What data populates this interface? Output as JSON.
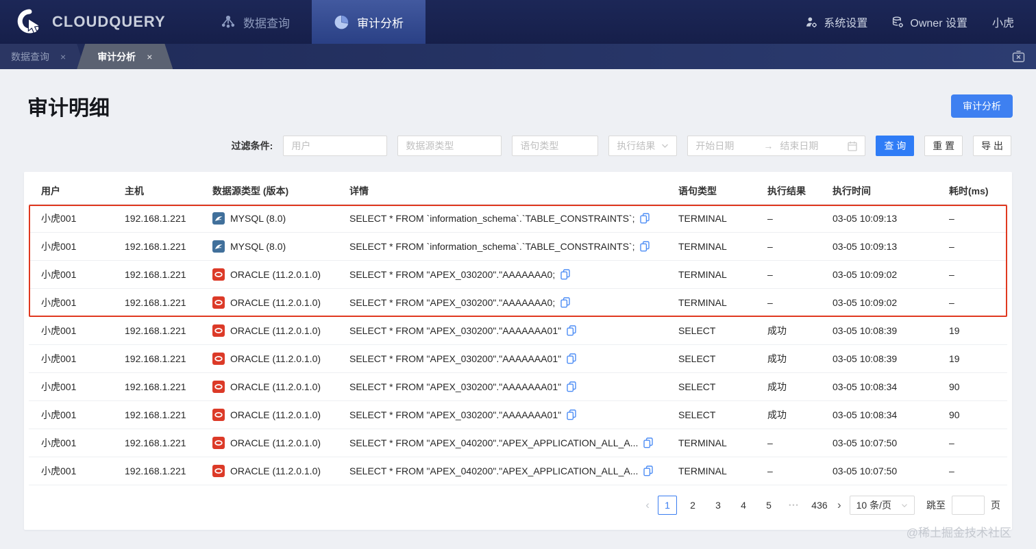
{
  "navbar": {
    "brand": "CLOUDQUERY",
    "items": [
      {
        "label": "数据查询",
        "icon": "network-icon"
      },
      {
        "label": "审计分析",
        "icon": "pie-chart-icon"
      }
    ],
    "right": [
      {
        "label": "系统设置",
        "icon": "user-gear-icon"
      },
      {
        "label": "Owner 设置",
        "icon": "database-gear-icon"
      },
      {
        "label": "小虎"
      }
    ]
  },
  "tabbar": {
    "tabs": [
      {
        "label": "数据查询",
        "active": false
      },
      {
        "label": "审计分析",
        "active": true
      }
    ]
  },
  "page": {
    "title": "审计明细",
    "action_button": "审计分析"
  },
  "filters": {
    "label": "过滤条件:",
    "user_placeholder": "用户",
    "datasource_placeholder": "数据源类型",
    "statement_placeholder": "语句类型",
    "result_placeholder": "执行结果",
    "start_date_placeholder": "开始日期",
    "date_arrow": "→",
    "end_date_placeholder": "结束日期",
    "query_button": "查 询",
    "reset_button": "重 置",
    "export_button": "导 出"
  },
  "table": {
    "columns": [
      "用户",
      "主机",
      "数据源类型 (版本)",
      "详情",
      "语句类型",
      "执行结果",
      "执行时间",
      "耗时(ms)"
    ],
    "rows": [
      {
        "user": "小虎001",
        "host": "192.168.1.221",
        "ds_kind": "mysql",
        "datasource": "MYSQL (8.0)",
        "detail": "SELECT * FROM `information_schema`.`TABLE_CONSTRAINTS`;",
        "stmt_type": "TERMINAL",
        "result": "–",
        "time": "03-05 10:09:13",
        "cost": "–",
        "highlighted": true
      },
      {
        "user": "小虎001",
        "host": "192.168.1.221",
        "ds_kind": "mysql",
        "datasource": "MYSQL (8.0)",
        "detail": "SELECT * FROM `information_schema`.`TABLE_CONSTRAINTS`;",
        "stmt_type": "TERMINAL",
        "result": "–",
        "time": "03-05 10:09:13",
        "cost": "–",
        "highlighted": true
      },
      {
        "user": "小虎001",
        "host": "192.168.1.221",
        "ds_kind": "oracle",
        "datasource": "ORACLE (11.2.0.1.0)",
        "detail": "SELECT * FROM \"APEX_030200\".\"AAAAAAA0;",
        "stmt_type": "TERMINAL",
        "result": "–",
        "time": "03-05 10:09:02",
        "cost": "–",
        "highlighted": true
      },
      {
        "user": "小虎001",
        "host": "192.168.1.221",
        "ds_kind": "oracle",
        "datasource": "ORACLE (11.2.0.1.0)",
        "detail": "SELECT * FROM \"APEX_030200\".\"AAAAAAA0;",
        "stmt_type": "TERMINAL",
        "result": "–",
        "time": "03-05 10:09:02",
        "cost": "–",
        "highlighted": true
      },
      {
        "user": "小虎001",
        "host": "192.168.1.221",
        "ds_kind": "oracle",
        "datasource": "ORACLE (11.2.0.1.0)",
        "detail": "SELECT * FROM \"APEX_030200\".\"AAAAAAA01\"",
        "stmt_type": "SELECT",
        "result": "成功",
        "time": "03-05 10:08:39",
        "cost": "19",
        "highlighted": false
      },
      {
        "user": "小虎001",
        "host": "192.168.1.221",
        "ds_kind": "oracle",
        "datasource": "ORACLE (11.2.0.1.0)",
        "detail": "SELECT * FROM \"APEX_030200\".\"AAAAAAA01\"",
        "stmt_type": "SELECT",
        "result": "成功",
        "time": "03-05 10:08:39",
        "cost": "19",
        "highlighted": false
      },
      {
        "user": "小虎001",
        "host": "192.168.1.221",
        "ds_kind": "oracle",
        "datasource": "ORACLE (11.2.0.1.0)",
        "detail": "SELECT * FROM \"APEX_030200\".\"AAAAAAA01\"",
        "stmt_type": "SELECT",
        "result": "成功",
        "time": "03-05 10:08:34",
        "cost": "90",
        "highlighted": false
      },
      {
        "user": "小虎001",
        "host": "192.168.1.221",
        "ds_kind": "oracle",
        "datasource": "ORACLE (11.2.0.1.0)",
        "detail": "SELECT * FROM \"APEX_030200\".\"AAAAAAA01\"",
        "stmt_type": "SELECT",
        "result": "成功",
        "time": "03-05 10:08:34",
        "cost": "90",
        "highlighted": false
      },
      {
        "user": "小虎001",
        "host": "192.168.1.221",
        "ds_kind": "oracle",
        "datasource": "ORACLE (11.2.0.1.0)",
        "detail": "SELECT * FROM \"APEX_040200\".\"APEX_APPLICATION_ALL_A...",
        "stmt_type": "TERMINAL",
        "result": "–",
        "time": "03-05 10:07:50",
        "cost": "–",
        "highlighted": false
      },
      {
        "user": "小虎001",
        "host": "192.168.1.221",
        "ds_kind": "oracle",
        "datasource": "ORACLE (11.2.0.1.0)",
        "detail": "SELECT * FROM \"APEX_040200\".\"APEX_APPLICATION_ALL_A...",
        "stmt_type": "TERMINAL",
        "result": "–",
        "time": "03-05 10:07:50",
        "cost": "–",
        "highlighted": false
      }
    ],
    "highlight_color": "#e0381f"
  },
  "pagination": {
    "prev": "‹",
    "next": "›",
    "pages": [
      "1",
      "2",
      "3",
      "4",
      "5",
      "•••",
      "436"
    ],
    "active_page": "1",
    "page_size": "10 条/页",
    "jump_label": "跳至",
    "jump_unit": "页",
    "jump_value": ""
  },
  "colors": {
    "navbar_bg": "#1a2450",
    "accent_blue": "#2f7cf6",
    "mysql_icon_bg": "#41709b",
    "oracle_icon_bg": "#dc3a28"
  },
  "watermark": "@稀土掘金技术社区"
}
